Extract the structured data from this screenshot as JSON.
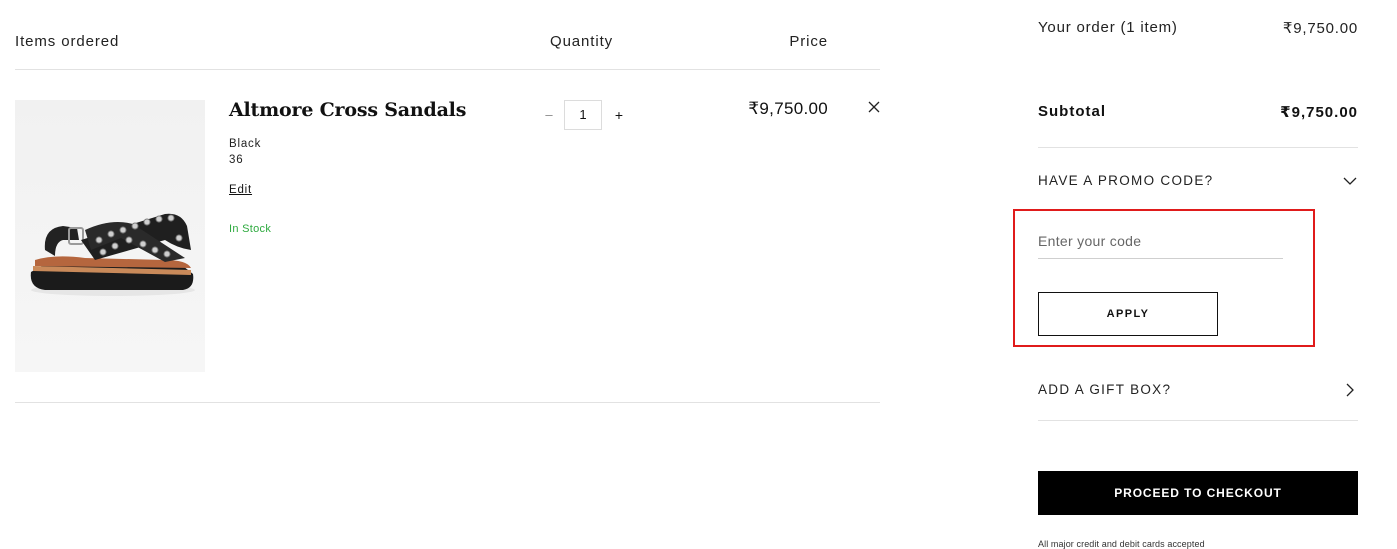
{
  "items_table": {
    "header_items": "Items ordered",
    "header_quantity": "Quantity",
    "header_price": "Price"
  },
  "item": {
    "name": "Altmore Cross Sandals",
    "color": "Black",
    "size": "36",
    "edit_label": "Edit",
    "stock_status": "In Stock",
    "stock_color": "#2eaa3f",
    "quantity": "1",
    "qty_minus": "–",
    "qty_plus": "+",
    "price": "₹9,750.00",
    "remove_icon": "close-icon",
    "image_alt": "sandal-image"
  },
  "summary": {
    "order_label": "Your order (1 item)",
    "order_total": "₹9,750.00",
    "subtotal_label": "Subtotal",
    "subtotal_value": "₹9,750.00",
    "promo_title": "HAVE A PROMO CODE?",
    "promo_placeholder": "Enter your code",
    "apply_label": "APPLY",
    "gift_title": "ADD A GIFT BOX?",
    "checkout_label": "PROCEED TO CHECKOUT",
    "cards_note": "All major credit and debit cards accepted"
  },
  "colors": {
    "highlight": "#e01b1b",
    "checkout_bg": "#000000"
  }
}
